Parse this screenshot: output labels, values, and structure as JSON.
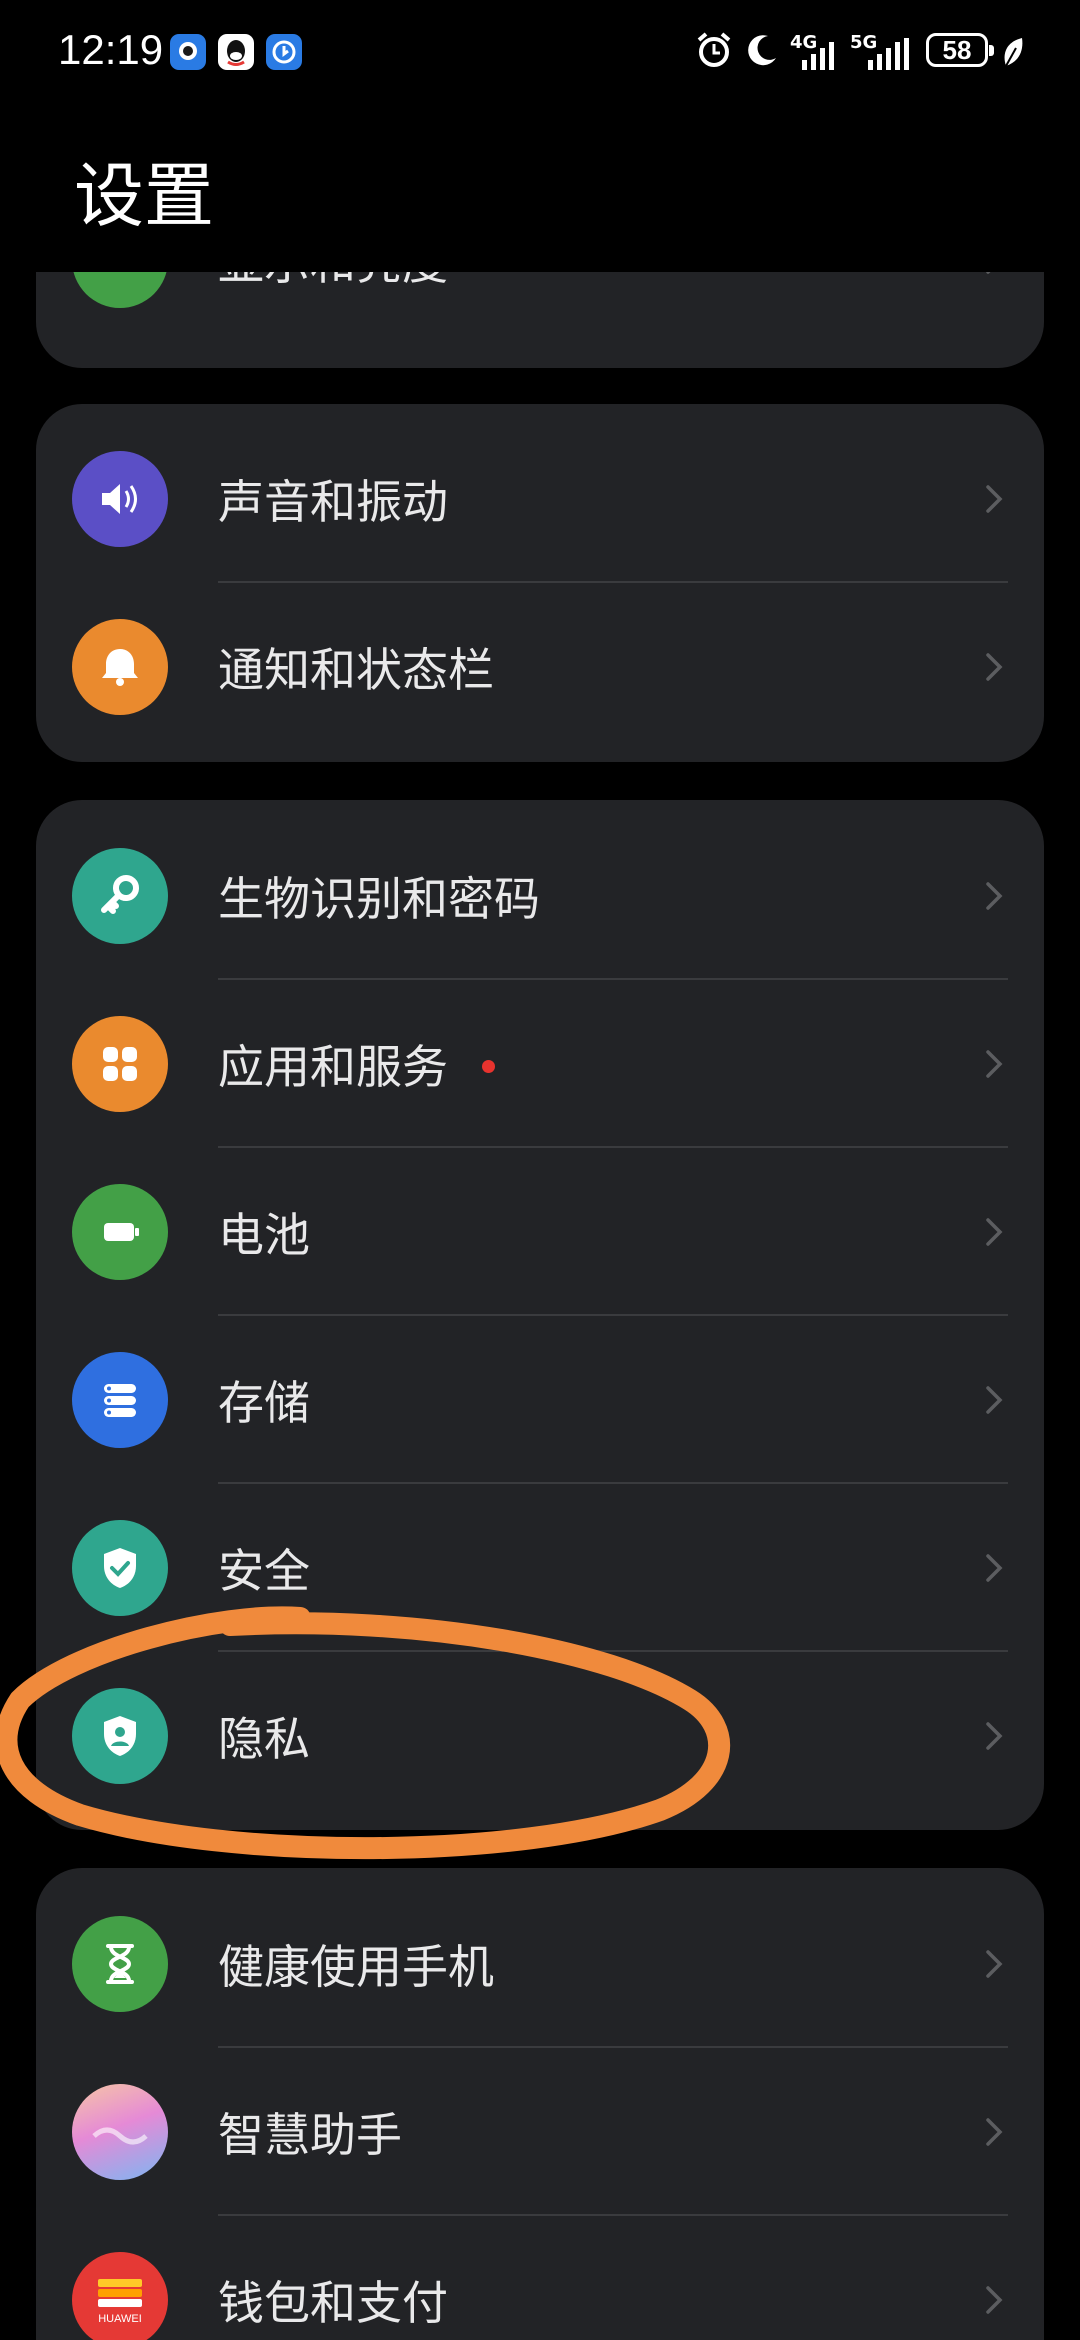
{
  "status_bar": {
    "time": "12:19",
    "network_1": "4G",
    "network_2": "5G",
    "battery": "58",
    "icons": [
      "notification-app-icon",
      "qq-icon",
      "notification-app-icon",
      "alarm-icon",
      "moon-icon",
      "signal-icon",
      "leaf-icon"
    ]
  },
  "header": {
    "title": "设置"
  },
  "sections": [
    {
      "items": [
        {
          "label": "显示和亮度",
          "icon": "display-icon",
          "color": "#43a047"
        }
      ]
    },
    {
      "items": [
        {
          "label": "声音和振动",
          "icon": "speaker-icon",
          "color": "#5b4fc6"
        },
        {
          "label": "通知和状态栏",
          "icon": "bell-icon",
          "color": "#ea8a2e"
        }
      ]
    },
    {
      "items": [
        {
          "label": "生物识别和密码",
          "icon": "key-icon",
          "color": "#2fa68e"
        },
        {
          "label": "应用和服务",
          "icon": "apps-icon",
          "color": "#ea8a2e",
          "badge": true
        },
        {
          "label": "电池",
          "icon": "battery-icon",
          "color": "#43a047"
        },
        {
          "label": "存储",
          "icon": "storage-icon",
          "color": "#2f6fe0"
        },
        {
          "label": "安全",
          "icon": "shield-check-icon",
          "color": "#2fa68e"
        },
        {
          "label": "隐私",
          "icon": "privacy-shield-icon",
          "color": "#2fa68e"
        }
      ]
    },
    {
      "items": [
        {
          "label": "健康使用手机",
          "icon": "hourglass-icon",
          "color": "#43a047"
        },
        {
          "label": "智慧助手",
          "icon": "assistant-icon",
          "color": "#c98ee0"
        },
        {
          "label": "钱包和支付",
          "icon": "wallet-icon",
          "color": "#e53935",
          "icon_text": "HUAWEI"
        }
      ]
    }
  ],
  "colors": {
    "accent_annotation": "#f08a3c",
    "background": "#000000",
    "card": "#222326"
  }
}
